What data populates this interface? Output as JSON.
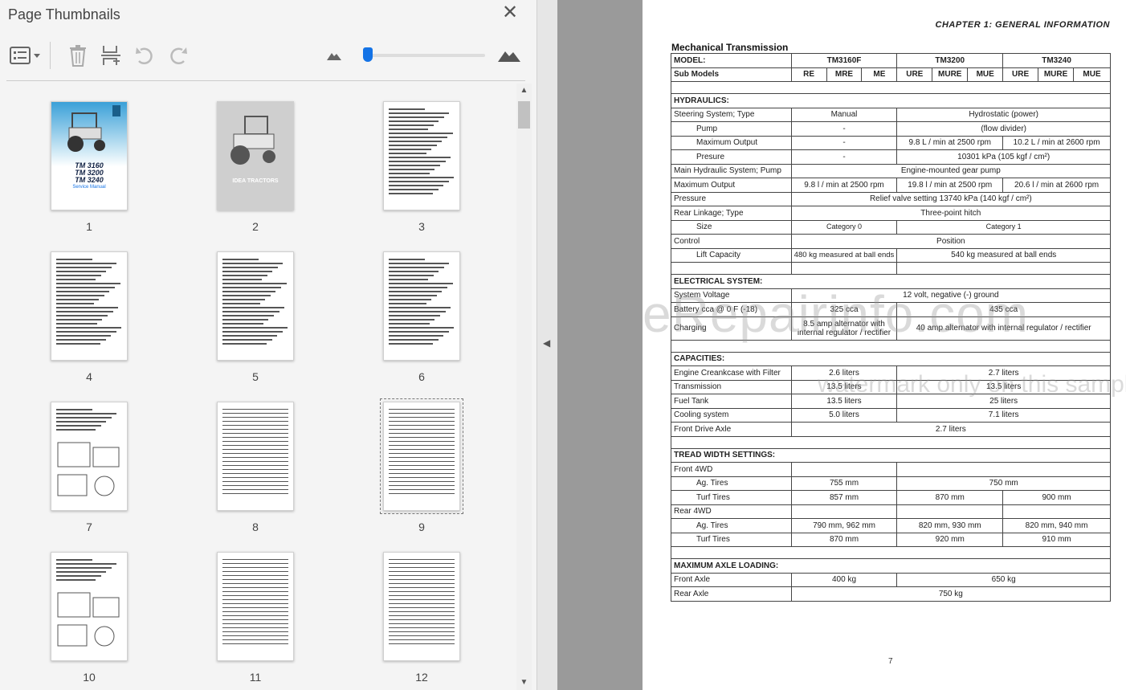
{
  "panel": {
    "title": "Page Thumbnails",
    "close_glyph": "✕"
  },
  "toolbar": {
    "icons": [
      "options-menu-icon",
      "delete-icon",
      "extract-pages-icon",
      "undo-icon",
      "redo-icon",
      "zoom-out-mountain-icon",
      "zoom-in-mountain-icon"
    ],
    "thumbnail_size_fraction": 0.02
  },
  "thumbnails": [
    {
      "label": "1",
      "kind": "cover",
      "cover_lines": [
        "TM 3160",
        "TM 3200",
        "TM 3240"
      ],
      "cover_sub": "Service Manual"
    },
    {
      "label": "2",
      "kind": "gray-cover",
      "cover_lines": [
        "IDEA TRACTORS"
      ]
    },
    {
      "label": "3",
      "kind": "toc"
    },
    {
      "label": "4",
      "kind": "toc"
    },
    {
      "label": "5",
      "kind": "toc"
    },
    {
      "label": "6",
      "kind": "toc"
    },
    {
      "label": "7",
      "kind": "figure"
    },
    {
      "label": "8",
      "kind": "table"
    },
    {
      "label": "9",
      "kind": "table",
      "selected": true
    },
    {
      "label": "10",
      "kind": "figure"
    },
    {
      "label": "11",
      "kind": "table"
    },
    {
      "label": "12",
      "kind": "table"
    }
  ],
  "document": {
    "chapter": "CHAPTER 1: GENERAL INFORMATION",
    "section": "Mechanical Transmission",
    "page_number": "7",
    "watermark_main": "eRepairinfo.com",
    "watermark_sub": "watermark only on this sample",
    "models": {
      "label": "MODEL:",
      "values": [
        "TM3160F",
        "TM3200",
        "TM3240"
      ]
    },
    "submodels": {
      "label": "Sub Models",
      "values": [
        "RE",
        "MRE",
        "ME",
        "URE",
        "MURE",
        "MUE",
        "URE",
        "MURE",
        "MUE"
      ]
    },
    "hydraulics": {
      "title": "HYDRAULICS:",
      "steering": [
        "Steering System; Type",
        "Manual",
        "Hydrostatic (power)"
      ],
      "pump": [
        "Pump",
        "-",
        "(flow divider)"
      ],
      "max_output": [
        "Maximum Output",
        "-",
        "9.8 L / min at 2500 rpm",
        "10.2 L / min at 2600 rpm"
      ],
      "presure": [
        "Presure",
        "-",
        "10301 kPa (105 kgf / cm²)"
      ],
      "main_pump": [
        "Main Hydraulic System; Pump",
        "Engine-mounted gear pump"
      ],
      "main_max": [
        "Maximum Output",
        "9.8 l / min at 2500 rpm",
        "19.8 l / min at 2500 rpm",
        "20.6 l / min at 2600 rpm"
      ],
      "pressure": [
        "Pressure",
        "Relief valve setting 13740 kPa (140 kgf / cm²)"
      ],
      "linkage": [
        "Rear Linkage; Type",
        "Three-point hitch"
      ],
      "size": [
        "Size",
        "Category 0",
        "Category 1"
      ],
      "control": [
        "Control",
        "Position"
      ],
      "lift": [
        "Lift Capacity",
        "480 kg measured at ball ends",
        "540 kg measured at ball ends"
      ]
    },
    "electrical": {
      "title": "ELECTRICAL SYSTEM:",
      "voltage": [
        "System Voltage",
        "12 volt, negative (-) ground"
      ],
      "battery": [
        "Battery cca @ 0 F (-18)",
        "325 cca",
        "435 cca"
      ],
      "charging": [
        "Charging",
        "8.5 amp alternator with internal regulator / rectifier",
        "40 amp alternator with internal regulator / rectifier"
      ]
    },
    "capacities": {
      "title": "CAPACITIES:",
      "crankcase": [
        "Engine Creankcase with Filter",
        "2.6 liters",
        "2.7 liters"
      ],
      "transmission": [
        "Transmission",
        "13.5 liters",
        "13.5 liters"
      ],
      "fuel": [
        "Fuel Tank",
        "13.5 liters",
        "25 liters"
      ],
      "cooling": [
        "Cooling system",
        "5.0 liters",
        "7.1 liters"
      ],
      "front_axle": [
        "Front Drive Axle",
        "2.7 liters"
      ]
    },
    "tread": {
      "title": "TREAD WIDTH SETTINGS:",
      "front": "Front 4WD",
      "front_ag": [
        "Ag. Tires",
        "755 mm",
        "750 mm"
      ],
      "front_turf": [
        "Turf Tires",
        "857 mm",
        "870 mm",
        "900 mm"
      ],
      "rear": "Rear 4WD",
      "rear_ag": [
        "Ag. Tires",
        "790 mm, 962 mm",
        "820 mm, 930 mm",
        "820 mm, 940 mm"
      ],
      "rear_turf": [
        "Turf Tires",
        "870 mm",
        "920 mm",
        "910 mm"
      ]
    },
    "axle": {
      "title": "MAXIMUM AXLE LOADING:",
      "front": [
        "Front Axle",
        "400 kg",
        "650 kg"
      ],
      "rear": [
        "Rear Axle",
        "750 kg"
      ]
    }
  }
}
